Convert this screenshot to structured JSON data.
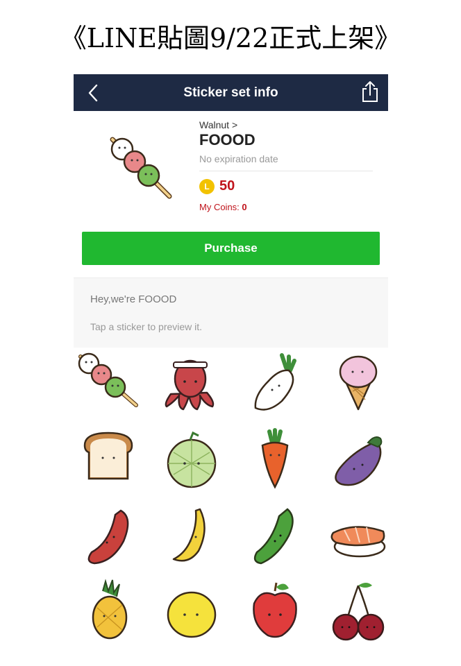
{
  "page_title": "《LINE貼圖9/22正式上架》",
  "nav": {
    "title": "Sticker set info",
    "back_icon": "chevron-left-icon",
    "share_icon": "share-icon"
  },
  "sticker_set": {
    "author": "Walnut >",
    "name": "FOOOD",
    "expiry": "No expiration date",
    "coin_icon_letter": "L",
    "price": "50",
    "my_coins_label": "My Coins:",
    "my_coins_value": "0"
  },
  "purchase_label": "Purchase",
  "description": "Hey,we're FOOOD",
  "preview_hint": "Tap a sticker to preview it.",
  "colors": {
    "navbar": "#1e2a44",
    "purchase": "#20b830",
    "price": "#c0141c",
    "coin": "#f2c200"
  },
  "stickers": [
    "dango",
    "octopus",
    "daikon",
    "ice-cream",
    "bread",
    "melon",
    "carrot",
    "eggplant",
    "sausage",
    "banana",
    "cucumber",
    "sushi",
    "pineapple",
    "lemon",
    "apple",
    "cherries"
  ]
}
